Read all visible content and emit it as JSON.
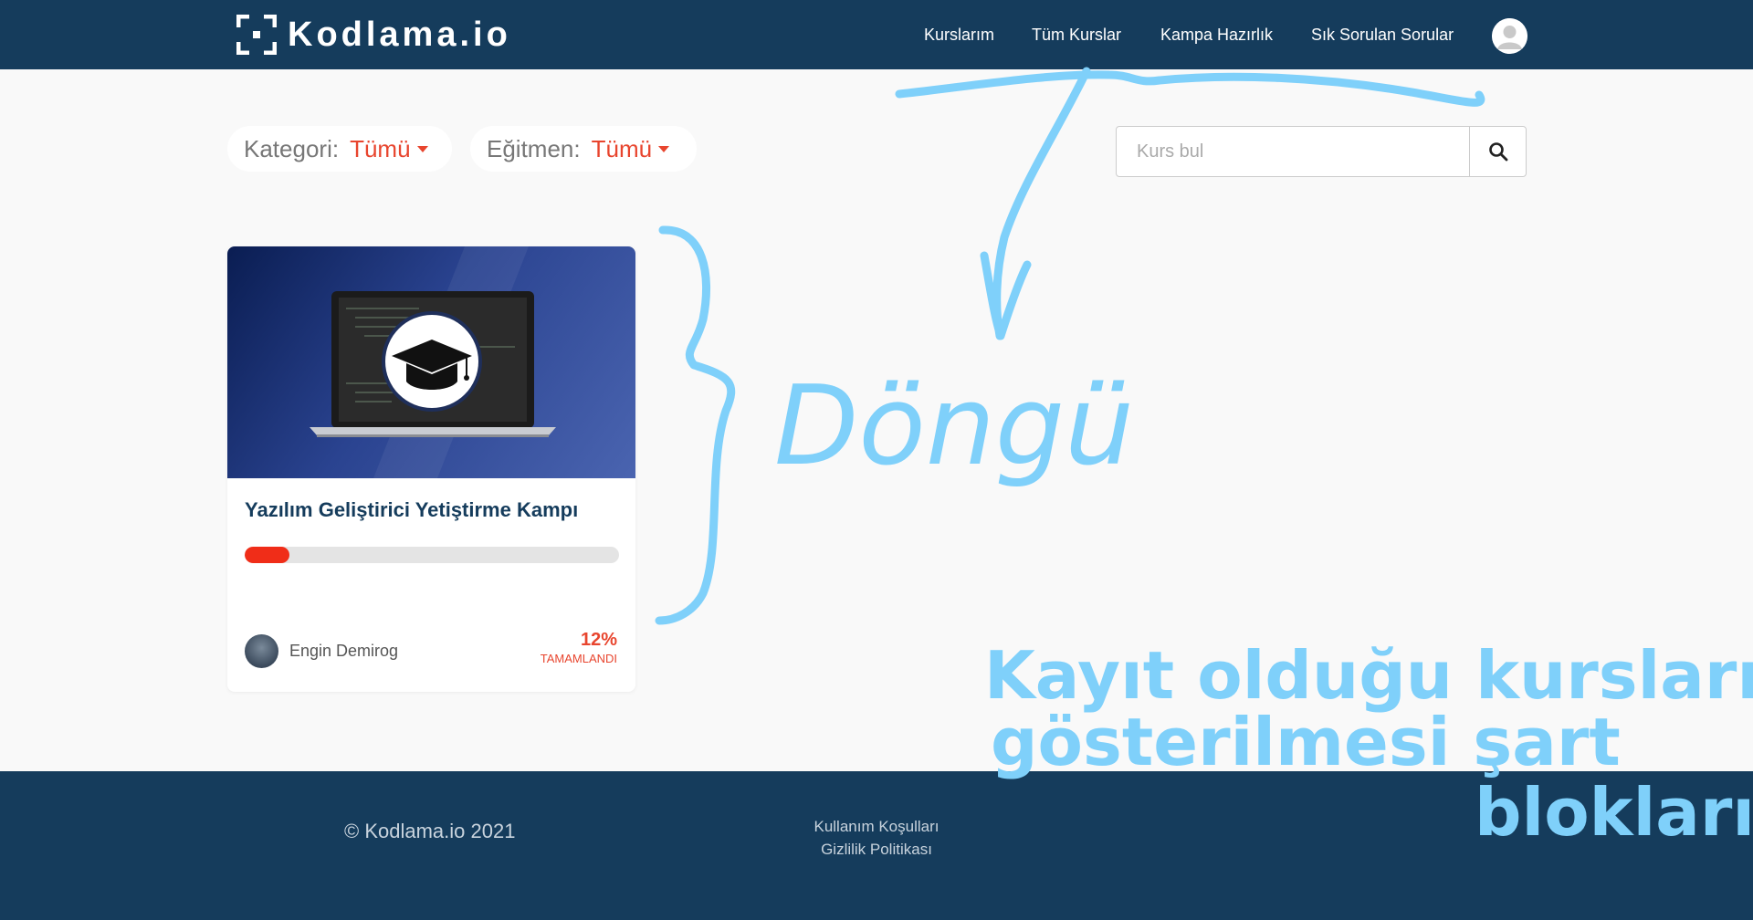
{
  "header": {
    "logo_text": "Kodlama.io",
    "nav": [
      {
        "label": "Kurslarım"
      },
      {
        "label": "Tüm Kurslar"
      },
      {
        "label": "Kampa Hazırlık"
      },
      {
        "label": "Sık Sorulan Sorular"
      }
    ]
  },
  "filters": {
    "category": {
      "label": "Kategori:",
      "value": "Tümü"
    },
    "instructor": {
      "label": "Eğitmen:",
      "value": "Tümü"
    }
  },
  "search": {
    "placeholder": "Kurs bul"
  },
  "course_card": {
    "title": "Yazılım Geliştirici Yetiştirme Kampı",
    "progress_percent": 12,
    "author": "Engin Demirog",
    "percent_label": "12%",
    "status": "TAMAMLANDI"
  },
  "footer": {
    "copyright": "© Kodlama.io 2021",
    "links": [
      "Kullanım Koşulları",
      "Gizlilik Politikası"
    ]
  },
  "annotations": {
    "loop_label": "Döngü",
    "note_line1": "Kayıt olduğu kursların",
    "note_line2": "gösterilmesi şart",
    "note_line3": "blokları",
    "color": "#7fd0fa"
  },
  "colors": {
    "navbar": "#153c5c",
    "accent": "#e8452e",
    "progress": "#f02d18"
  },
  "icons": [
    "logo-mark-icon",
    "user-avatar-icon",
    "caret-down-icon",
    "search-icon",
    "graduation-cap-icon"
  ]
}
